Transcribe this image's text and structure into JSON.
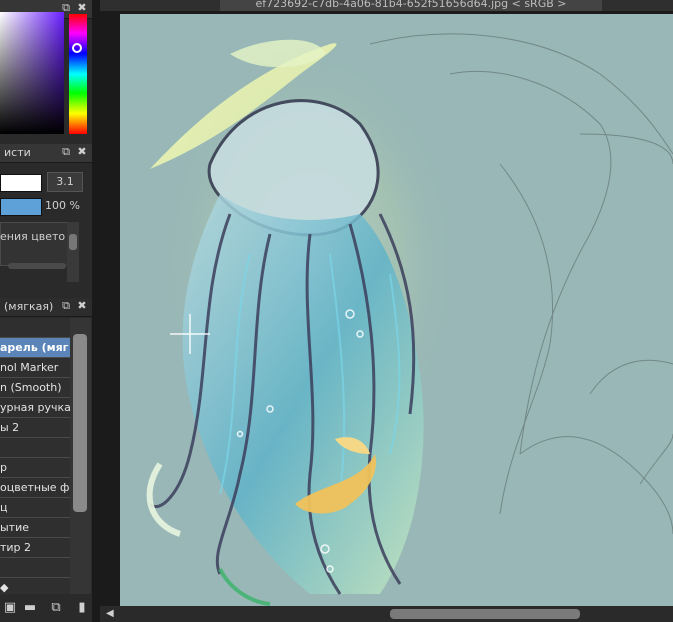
{
  "document_tab": {
    "title": "ef723692-c7db-4a06-81b4-652f51656d64.jpg < sRGB >"
  },
  "color_panel": {
    "icons": [
      "popout-icon",
      "close-icon"
    ]
  },
  "brush_props": {
    "title": "исти",
    "size_value": "3.1",
    "opacity_value": "100 %",
    "blend_label": "ения цвето"
  },
  "brush_list": {
    "title": "(мягкая)",
    "items": [
      {
        "label": ""
      },
      {
        "label": "арель (мяг",
        "selected": true
      },
      {
        "label": "nol Marker"
      },
      {
        "label": "n (Smooth)"
      },
      {
        "label": "урная ручка"
      },
      {
        "label": "ы 2"
      },
      {
        "label": ""
      },
      {
        "label": "р"
      },
      {
        "label": "оцветные ф"
      },
      {
        "label": "ц"
      },
      {
        "label": "ытие"
      },
      {
        "label": "тир 2"
      },
      {
        "label": ""
      },
      {
        "label": "◆"
      }
    ]
  },
  "colors": {
    "accent": "#5b84b8",
    "canvas_bg": "#98b7b6"
  }
}
